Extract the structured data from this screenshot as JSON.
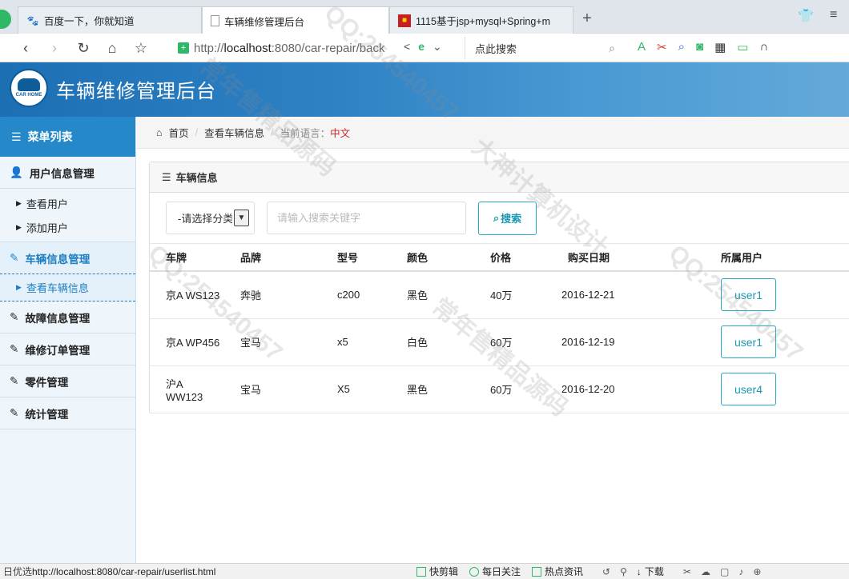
{
  "browser": {
    "tabs": [
      {
        "label": "百度一下，你就知道",
        "icon": "paw-icon"
      },
      {
        "label": "车辆维修管理后台",
        "icon": "document-icon"
      },
      {
        "label": "1115基于jsp+mysql+Spring+m",
        "icon": "site-icon"
      }
    ],
    "url_prefix": "http://",
    "url_host": "localhost",
    "url_rest": ":8080/car-repair/back",
    "search_placeholder": "点此搜索",
    "status_left": "日优选",
    "status_url": "http://localhost:8080/car-repair/userlist.html",
    "status_items": [
      "快剪辑",
      "每日关注",
      "热点资讯",
      "下载"
    ]
  },
  "app": {
    "title": "车辆维修管理后台",
    "logo_text": "CAR HOME"
  },
  "sidebar": {
    "title": "菜单列表",
    "sections": [
      {
        "label": "用户信息管理",
        "icon": "user-icon",
        "items": [
          "查看用户",
          "添加用户"
        ]
      },
      {
        "label": "车辆信息管理",
        "icon": "edit-icon",
        "items": [
          "查看车辆信息"
        ],
        "active": true
      },
      {
        "label": "故障信息管理",
        "icon": "edit-icon"
      },
      {
        "label": "维修订单管理",
        "icon": "edit-icon"
      },
      {
        "label": "零件管理",
        "icon": "edit-icon"
      },
      {
        "label": "统计管理",
        "icon": "edit-icon"
      }
    ]
  },
  "breadcrumb": {
    "home": "首页",
    "current": "查看车辆信息",
    "lang_label": "当前语言：",
    "lang_value": "中文"
  },
  "panel": {
    "title": "车辆信息",
    "select_value": "-请选择分类",
    "search_placeholder": "请输入搜索关键字",
    "search_button": "搜索"
  },
  "table": {
    "headers": [
      "车牌",
      "品牌",
      "型号",
      "颜色",
      "价格",
      "购买日期",
      "所属用户"
    ],
    "rows": [
      {
        "plate": "京A WS123",
        "brand": "奔驰",
        "model": "c200",
        "color": "黑色",
        "price": "40万",
        "date": "2016-12-21",
        "user": "user1"
      },
      {
        "plate": "京A WP456",
        "brand": "宝马",
        "model": "x5",
        "color": "白色",
        "price": "60万",
        "date": "2016-12-19",
        "user": "user1"
      },
      {
        "plate": "沪A WW123",
        "brand": "宝马",
        "model": "X5",
        "color": "黑色",
        "price": "60万",
        "date": "2016-12-20",
        "user": "user4"
      }
    ]
  },
  "watermark": {
    "lines": [
      "大神计算机设计",
      "QQ:254540457",
      "常年售精品源码"
    ]
  }
}
